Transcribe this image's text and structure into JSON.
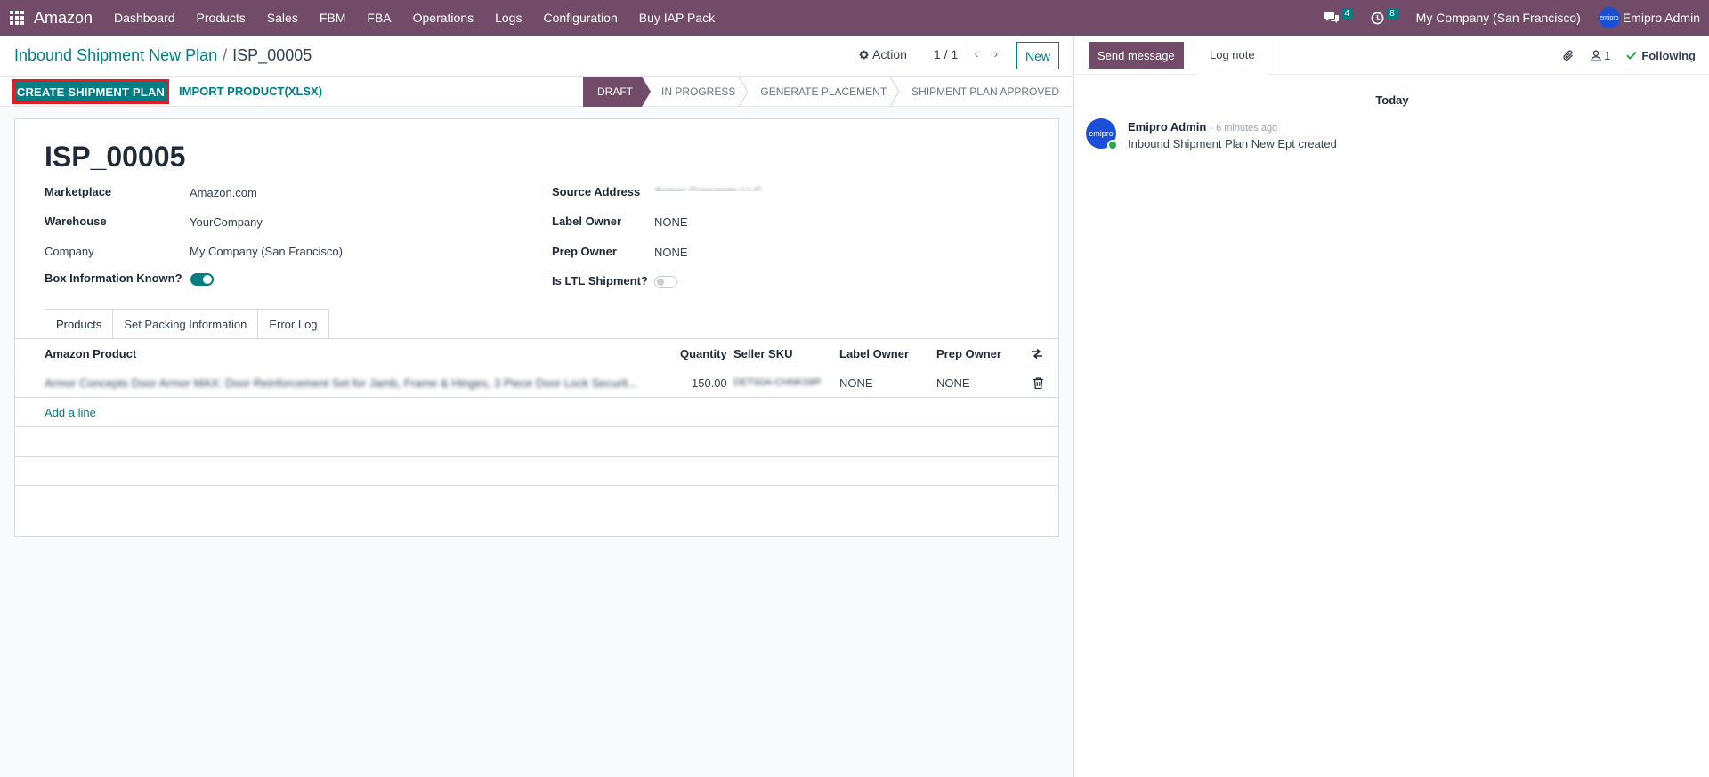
{
  "navbar": {
    "app_name": "Amazon",
    "menu": [
      "Dashboard",
      "Products",
      "Sales",
      "FBM",
      "FBA",
      "Operations",
      "Logs",
      "Configuration",
      "Buy IAP Pack"
    ],
    "messages_count": "4",
    "activities_count": "8",
    "company": "My Company (San Francisco)",
    "user": "Emipro Admin",
    "avatar_text": "emipro"
  },
  "control": {
    "breadcrumb_parent": "Inbound Shipment New Plan",
    "breadcrumb_sep": "/",
    "breadcrumb_current": "ISP_00005",
    "action_label": "Action",
    "pager": "1 / 1",
    "new_label": "New"
  },
  "statusbar": {
    "create_plan": "CREATE SHIPMENT PLAN",
    "import_product": "IMPORT PRODUCT(XLSX)",
    "stages": [
      "DRAFT",
      "IN PROGRESS",
      "GENERATE PLACEMENT",
      "SHIPMENT PLAN APPROVED"
    ],
    "active_stage": "DRAFT"
  },
  "form": {
    "title": "ISP_00005",
    "marketplace_label": "Marketplace",
    "marketplace_value": "Amazon.com",
    "warehouse_label": "Warehouse",
    "warehouse_value": "YourCompany",
    "company_label": "Company",
    "company_value": "My Company (San Francisco)",
    "box_info_label": "Box Information Known?",
    "box_info_on": true,
    "source_address_label": "Source Address",
    "source_address_value": "Armor Concepts LLC",
    "label_owner_label": "Label Owner",
    "label_owner_value": "NONE",
    "prep_owner_label": "Prep Owner",
    "prep_owner_value": "NONE",
    "ltl_label": "Is LTL Shipment?",
    "ltl_on": false
  },
  "tabs": [
    "Products",
    "Set Packing Information",
    "Error Log"
  ],
  "products_table": {
    "headers": [
      "Amazon Product",
      "Quantity",
      "Seller SKU",
      "Label Owner",
      "Prep Owner"
    ],
    "rows": [
      {
        "product": "Armor Concepts Door Armor MAX: Door Reinforcement Set for Jamb, Frame & Hinges, 3 Piece Door Lock Securit...",
        "quantity": "150.00",
        "sku": "DETS0A-CHNKS8P",
        "label_owner": "NONE",
        "prep_owner": "NONE"
      }
    ],
    "add_line": "Add a line"
  },
  "chatter": {
    "send_message": "Send message",
    "log_note": "Log note",
    "followers_count": "1",
    "following": "Following",
    "date_separator": "Today",
    "messages": [
      {
        "author": "Emipro Admin",
        "time": "- 6 minutes ago",
        "body": "Inbound Shipment Plan New Ept created"
      }
    ]
  },
  "colors": {
    "brand": "#714b67",
    "accent": "#017e84",
    "highlight": "#e11d26",
    "following": "#28a745"
  }
}
